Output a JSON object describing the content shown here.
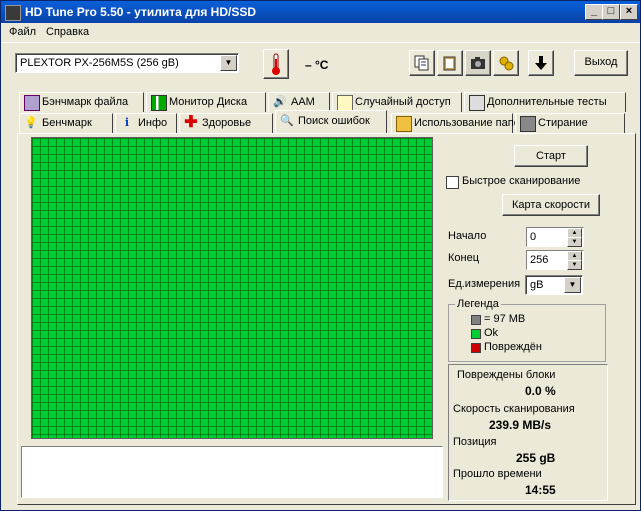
{
  "window": {
    "title": "HD Tune Pro 5.50 - утилита для HD/SSD"
  },
  "menu": {
    "file": "Файл",
    "help": "Справка"
  },
  "toolbar": {
    "drive": "PLEXTOR PX-256M5S (256 gB)",
    "temperature": "– °C",
    "exit_label": "Выход"
  },
  "tabs_top": [
    {
      "label": "Бэнчмарк файла",
      "icon": "file-benchmark-icon"
    },
    {
      "label": "Монитор Диска",
      "icon": "disk-monitor-icon"
    },
    {
      "label": "AAM",
      "icon": "speaker-icon"
    },
    {
      "label": "Случайный доступ",
      "icon": "random-access-icon"
    },
    {
      "label": "Дополнительные тесты",
      "icon": "extra-tests-icon"
    }
  ],
  "tabs_bottom": [
    {
      "label": "Бенчмарк",
      "icon": "benchmark-icon"
    },
    {
      "label": "Инфо",
      "icon": "info-icon"
    },
    {
      "label": "Здоровье",
      "icon": "health-icon"
    },
    {
      "label": "Поиск ошибок",
      "icon": "magnifier-icon"
    },
    {
      "label": "Использование папок",
      "icon": "folder-icon"
    },
    {
      "label": "Стирание",
      "icon": "trash-icon"
    }
  ],
  "controls": {
    "start": "Старт",
    "quick_scan": "Быстрое сканирование",
    "quick_scan_checked": false,
    "speed_map": "Карта скорости",
    "start_label": "Начало",
    "start_value": "0",
    "end_label": "Конец",
    "end_value": "256",
    "unit_label": "Ед.измерения",
    "unit_value": "gB"
  },
  "legend": {
    "title": "Легенда",
    "block": "= 97 MB",
    "ok": "Ok",
    "damaged": "Повреждён",
    "colors": {
      "block": "#808080",
      "ok": "#00cc33",
      "damaged": "#cc0000"
    }
  },
  "stats": {
    "damaged_label": "Повреждены блоки",
    "damaged_value": "0.0 %",
    "speed_label": "Скорость сканирования",
    "speed_value": "239.9 MB/s",
    "position_label": "Позиция",
    "position_value": "255 gB",
    "elapsed_label": "Прошло времени",
    "elapsed_value": "14:55"
  }
}
